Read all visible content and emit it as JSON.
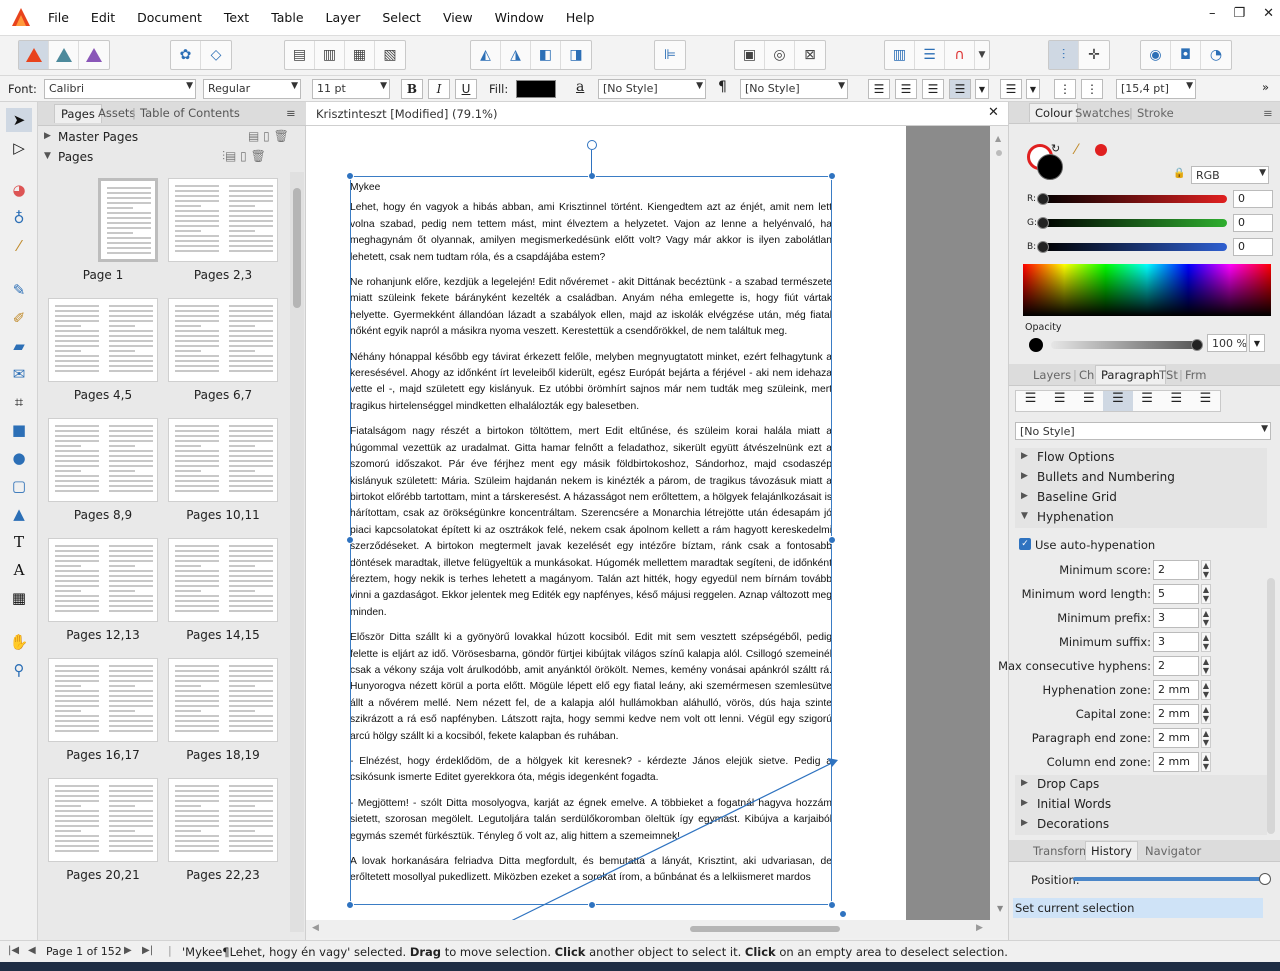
{
  "menubar": {
    "items": [
      "File",
      "Edit",
      "Document",
      "Text",
      "Table",
      "Layer",
      "Select",
      "View",
      "Window",
      "Help"
    ],
    "window_controls": [
      "–",
      "❐",
      "✕"
    ]
  },
  "contextbar": {
    "font_label": "Font:",
    "font_value": "Calibri",
    "style_value": "Regular",
    "size_value": "11 pt",
    "bold": "B",
    "italic": "I",
    "underline": "U",
    "fill_label": "Fill:",
    "char_style": "[No Style]",
    "para_style": "[No Style]",
    "leading": "[15,4 pt]",
    "char_icon": "a",
    "para_icon": "¶"
  },
  "pages_panel": {
    "tabs": [
      "Pages",
      "Assets",
      "Table of Contents"
    ],
    "master_pages": "Master Pages",
    "pages": "Pages",
    "thumbnails": [
      "Page 1",
      "Pages 2,3",
      "Pages 4,5",
      "Pages 6,7",
      "Pages 8,9",
      "Pages 10,11",
      "Pages 12,13",
      "Pages 14,15",
      "Pages 16,17",
      "Pages 18,19",
      "Pages 20,21",
      "Pages 22,23"
    ]
  },
  "document": {
    "tab_title": "Krisztinteszt [Modified] (79.1%)",
    "heading": "Mykee",
    "paragraphs": [
      "Lehet, hogy én vagyok a hibás abban, ami Krisztinnel történt. Kiengedtem azt az énjét, amit nem lett volna szabad, pedig nem tettem mást, mint élveztem a helyzetet. Vajon az lenne a helyénvaló, ha meghagynám őt olyannak, amilyen megismerkedésünk előtt volt? Vagy már akkor is ilyen zabolátlan lehetett, csak nem tudtam róla, és a csapdájába estem?",
      "Ne rohanjunk előre, kezdjük a legelején! Edit nővéremet - akit Dittának becéztünk - a szabad természete miatt szüleink fekete bárányként kezelték a családban. Anyám néha emlegette is, hogy fiút vártak helyette. Gyermekként állandóan lázadt a szabályok ellen, majd az iskolák elvégzése után, még fiatal nőként egyik napról a másikra nyoma veszett. Kerestettük a csendőrökkel, de nem találtuk meg.",
      "Néhány hónappal később egy távirat érkezett felőle, melyben megnyugtatott minket, ezért felhagytunk a keresésével. Ahogy az időnként írt leveleiből kiderült, egész Európát bejárta a férjével - aki nem idehaza vette el -, majd született egy kislányuk. Ez utóbbi örömhírt sajnos már nem tudták meg szüleink, mert tragikus hirtelenséggel mindketten elhalálozták egy balesetben.",
      "Fiatalságom nagy részét a birtokon töltöttem, mert Edit eltűnése, és szüleim korai halála miatt a húgommal vezettük az uradalmat. Gitta hamar felnőtt a feladathoz, sikerült együtt átvészelnünk ezt a szomorú időszakot. Pár éve férjhez ment egy másik földbirtokoshoz, Sándorhoz, majd csodaszép kislányuk született: Mária. Szüleim hajdanán nekem is kinézték a párom, de tragikus távozásuk miatt a birtokot előrébb tartottam, mint a társkeresést. A házasságot nem erőltettem, a hölgyek felajánlkozásait is hárítottam, csak az örökségünkre koncentráltam. Szerencsére a Monarchia létrejötte után édesapám jó piaci kapcsolatokat épített ki az osztrákok felé, nekem csak ápolnom kellett a rám hagyott kereskedelmi szerződéseket. A birtokon megtermelt javak kezelését egy intézőre bíztam, ránk csak a fontosabb döntések maradtak, illetve felügyeltük a munkásokat. Húgomék mellettem maradtak segíteni, de időnként éreztem, hogy nekik is terhes lehetett a magányom. Talán azt hitték, hogy egyedül nem bírnám tovább vinni a gazdaságot. Ekkor jelentek meg Editék egy napfényes, késő májusi reggelen. Aznap változott meg minden.",
      "Először Ditta szállt ki a gyönyörű lovakkal húzott kocsiból. Edit mit sem vesztett szépségéből, pedig felette is eljárt az idő. Vörösesbarna, göndör fürtjei kibújtak világos színű kalapja alól. Csillogó szemeinél csak a vékony szája volt árulkodóbb, amit anyánktól örökölt. Nemes, kemény vonásai apánkról száltt rá. Hunyorogva nézett körül a porta előtt. Mögüle lépett elő egy fiatal leány, aki szemérmesen szemlesütve állt a nővérem mellé. Nem nézett fel, de a kalapja alól hullámokban aláhulló, vörös, dús haja szinte szikrázott a rá eső napfényben. Látszott rajta, hogy semmi kedve nem volt ott lenni. Végül egy szigorú arcú hölgy szállt ki a kocsiból, fekete kalapban és ruhában.",
      "- Elnézést, hogy érdeklődöm, de a hölgyek kit keresnek? - kérdezte János elejük sietve. Pedig a csikósunk ismerte Editet gyerekkora óta, mégis idegenként fogadta.",
      "- Megjöttem! - szólt Ditta mosolyogva, karját az égnek emelve. A többieket a fogatnál hagyva hozzám sietett, szorosan megölelt. Legutoljára talán serdülőkoromban öleltük így egymást. Kibújva a karjaiból egymás szemét fürkésztük. Tényleg ő volt az, alig hittem a szemeimnek!",
      "A lovak horkanására felriadva Ditta megfordult, és bemutatta a lányát, Krisztint, aki udvariasan, de erőltetett mosollyal pukedlizett. Miközben ezeket a sorokat írom, a bűnbánat és a lelkiismeret mardos"
    ]
  },
  "right_panel": {
    "colour_tabs": [
      "Colour",
      "Swatches",
      "Stroke"
    ],
    "model": "RGB",
    "r_label": "R:",
    "r_value": "0",
    "g_label": "G:",
    "g_value": "0",
    "b_label": "B:",
    "b_value": "0",
    "opacity_label": "Opacity",
    "opacity_value": "100 %",
    "para_tabs": [
      "Layers",
      "Chr",
      "Paragraph",
      "TSt",
      "Frm"
    ],
    "para_style": "[No Style]",
    "sections_top": [
      "Flow Options",
      "Bullets and Numbering",
      "Baseline Grid",
      "Hyphenation"
    ],
    "auto_hyph": "Use auto-hypenation",
    "hyph_fields": [
      {
        "label": "Minimum score:",
        "value": "2"
      },
      {
        "label": "Minimum word length:",
        "value": "5"
      },
      {
        "label": "Minimum prefix:",
        "value": "3"
      },
      {
        "label": "Minimum suffix:",
        "value": "3"
      },
      {
        "label": "Max consecutive hyphens:",
        "value": "2"
      },
      {
        "label": "Hyphenation zone:",
        "value": "2 mm"
      },
      {
        "label": "Capital zone:",
        "value": "2 mm"
      },
      {
        "label": "Paragraph end zone:",
        "value": "2 mm"
      },
      {
        "label": "Column end zone:",
        "value": "2 mm"
      }
    ],
    "sections_bottom": [
      "Drop Caps",
      "Initial Words",
      "Decorations"
    ],
    "history_tabs": [
      "Transform",
      "History",
      "Navigator"
    ],
    "position_label": "Position:",
    "history_item": "Set current selection"
  },
  "status": {
    "page": "Page 1 of 152",
    "message_selected": "'Mykee¶Lehet, hogy én vagy' selected.",
    "drag": "Drag",
    "drag_text": "to move selection.",
    "click": "Click",
    "click_text": "another object to select it.",
    "click2": "Click",
    "click2_text": "on an empty area to deselect selection."
  },
  "colors": {
    "accent": "#2f73c0",
    "fill": "#000000",
    "red_swatch": "#e02020"
  }
}
